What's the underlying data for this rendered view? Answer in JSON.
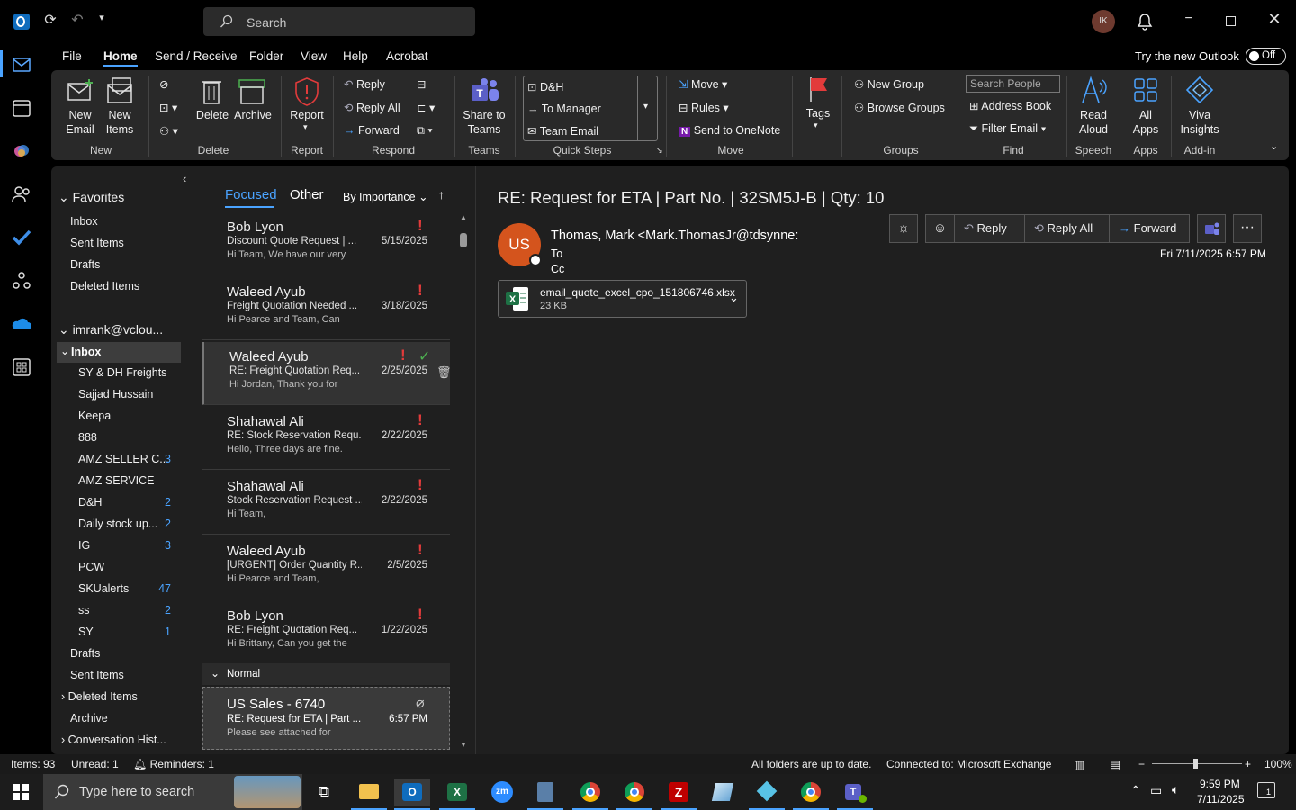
{
  "titlebar": {
    "search_placeholder": "Search",
    "avatar_initials": "IK"
  },
  "menu": [
    "File",
    "Home",
    "Send / Receive",
    "Folder",
    "View",
    "Help",
    "Acrobat"
  ],
  "try_new": {
    "label": "Try the new Outlook",
    "toggle": "Off"
  },
  "ribbon": {
    "new_email": "New\nEmail",
    "new_items": "New\nItems",
    "delete": "Delete",
    "archive": "Archive",
    "report": "Report",
    "reply": "Reply",
    "reply_all": "Reply All",
    "forward": "Forward",
    "share_teams": "Share to\nTeams",
    "quick_steps": [
      "D&H",
      "To Manager",
      "Team Email"
    ],
    "move": "Move",
    "rules": "Rules",
    "onenote": "Send to OneNote",
    "tags": "Tags",
    "new_group": "New Group",
    "browse_groups": "Browse Groups",
    "search_people": "Search People",
    "address_book": "Address Book",
    "filter_email": "Filter Email",
    "read_aloud": "Read\nAloud",
    "all_apps": "All\nApps",
    "viva": "Viva\nInsights",
    "groups": [
      "New",
      "Delete",
      "Report",
      "Respond",
      "Teams",
      "Quick Steps",
      "Move",
      "Groups",
      "Find",
      "Speech",
      "Apps",
      "Add-in"
    ]
  },
  "folders": {
    "favorites": "Favorites",
    "fav_items": [
      "Inbox",
      "Sent Items",
      "Drafts",
      "Deleted Items"
    ],
    "account": "imrank@vclou...",
    "inbox": "Inbox",
    "subfolders": [
      {
        "name": "SY & DH Freights",
        "count": ""
      },
      {
        "name": "Sajjad Hussain",
        "count": ""
      },
      {
        "name": "Keepa",
        "count": ""
      },
      {
        "name": "888",
        "count": ""
      },
      {
        "name": "AMZ SELLER C...",
        "count": "3"
      },
      {
        "name": "AMZ SERVICE",
        "count": ""
      },
      {
        "name": "D&H",
        "count": "2"
      },
      {
        "name": "Daily stock up...",
        "count": "2"
      },
      {
        "name": "IG",
        "count": "3"
      },
      {
        "name": "PCW",
        "count": ""
      },
      {
        "name": "SKUalerts",
        "count": "47"
      },
      {
        "name": "ss",
        "count": "2"
      },
      {
        "name": "SY",
        "count": "1"
      }
    ],
    "account_items": [
      "Drafts",
      "Sent Items",
      "Deleted Items",
      "Archive",
      "Conversation Hist..."
    ]
  },
  "list": {
    "tab_focused": "Focused",
    "tab_other": "Other",
    "sort": "By Importance",
    "normal_header": "Normal",
    "messages": [
      {
        "from": "Bob Lyon",
        "subject": "Discount Quote Request | ...",
        "preview": "Hi Team,  We have our very",
        "date": "5/15/2025"
      },
      {
        "from": "Waleed Ayub",
        "subject": "Freight Quotation Needed ...",
        "preview": "Hi Pearce and Team,  Can",
        "date": "3/18/2025"
      },
      {
        "from": "Waleed Ayub",
        "subject": "RE: Freight Quotation Req...",
        "preview": "Hi Jordan,  Thank you for",
        "date": "2/25/2025"
      },
      {
        "from": "Shahawal Ali",
        "subject": "RE: Stock Reservation Requ...",
        "preview": "Hello,  Three days are fine.",
        "date": "2/22/2025"
      },
      {
        "from": "Shahawal Ali",
        "subject": "Stock Reservation Request ...",
        "preview": "Hi Team,",
        "date": "2/22/2025"
      },
      {
        "from": "Waleed Ayub",
        "subject": "[URGENT] Order Quantity R...",
        "preview": "Hi Pearce and Team,",
        "date": "2/5/2025"
      },
      {
        "from": "Bob Lyon",
        "subject": "RE: Freight Quotation Req...",
        "preview": "Hi Brittany,  Can you get the",
        "date": "1/22/2025"
      }
    ],
    "normal_message": {
      "from": "US Sales - 6740",
      "subject": "RE: Request for ETA | Part ...",
      "preview": "Please see attached for",
      "date": "6:57 PM"
    }
  },
  "reading": {
    "subject": "RE: Request for ETA | Part No. | 32SM5J-B |  Qty: 10",
    "avatar": "US",
    "sender": "Thomas, Mark <Mark.ThomasJr@tdsynne:",
    "to": "To",
    "cc": "Cc",
    "date": "Fri 7/11/2025 6:57 PM",
    "reply": "Reply",
    "reply_all": "Reply All",
    "forward": "Forward",
    "attachment": {
      "name": "email_quote_excel_cpo_151806746.xlsx",
      "size": "23 KB"
    }
  },
  "status": {
    "items": "Items: 93",
    "unread": "Unread: 1",
    "reminders": "Reminders: 1",
    "sync": "All folders are up to date.",
    "connection": "Connected to: Microsoft Exchange",
    "zoom": "100%"
  },
  "taskbar": {
    "search_placeholder": "Type here to search",
    "time": "9:59 PM",
    "date": "7/11/2025",
    "notifications": "1"
  }
}
